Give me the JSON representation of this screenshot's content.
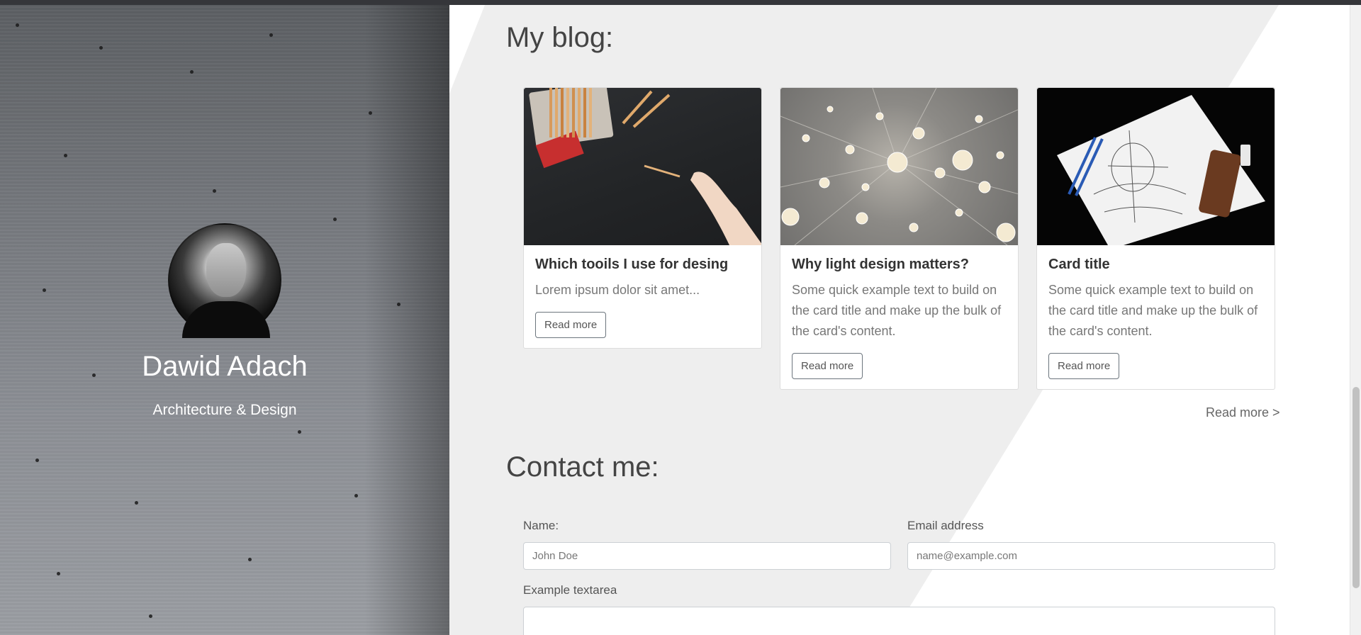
{
  "profile": {
    "name": "Dawid Adach",
    "role": "Architecture & Design"
  },
  "blog": {
    "heading": "My blog:",
    "cards": [
      {
        "title": "Which tooils I use for desing",
        "text": "Lorem ipsum dolor sit amet...",
        "button": "Read more"
      },
      {
        "title": "Why light design matters?",
        "text": "Some quick example text to build on the card title and make up the bulk of the card's content.",
        "button": "Read more"
      },
      {
        "title": "Card title",
        "text": "Some quick example text to build on the card title and make up the bulk of the card's content.",
        "button": "Read more"
      }
    ],
    "more_link": "Read more >"
  },
  "contact": {
    "heading": "Contact me:",
    "name_label": "Name:",
    "name_placeholder": "John Doe",
    "email_label": "Email address",
    "email_placeholder": "name@example.com",
    "textarea_label": "Example textarea"
  },
  "colors": {
    "page_bg": "#ffffff",
    "panel_bg": "#eeeeee",
    "button_border": "#6c757d"
  }
}
